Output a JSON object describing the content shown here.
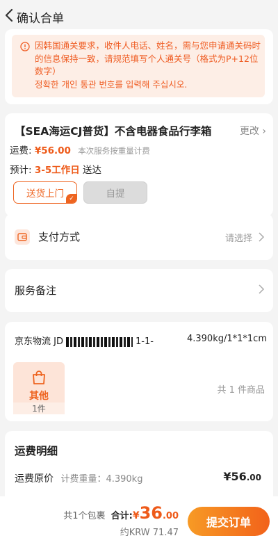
{
  "header": {
    "title": "确认合单"
  },
  "notice": {
    "text": "因韩国通关要求，收件人电话、姓名，需与您申请通关码时的信息保持一致，请规范填写个人通关号（格式为P+12位数字）",
    "text_kr": "정확한 개인 통관 번호를 입력해 주십시오."
  },
  "shipping": {
    "title": "【SEA海运CJ普货】不含电器食品行李箱",
    "change_label": "更改",
    "fee_label": "运费:",
    "fee_value": "¥56.00",
    "fee_hint": "本次服务按重量计费",
    "eta_label": "预计:",
    "eta_value": "3-5工作日",
    "eta_suffix": "送达",
    "options": {
      "door": "送货上门",
      "pickup": "自提"
    }
  },
  "payment": {
    "title": "支付方式",
    "placeholder": "请选择"
  },
  "memo": {
    "title": "服务备注"
  },
  "package": {
    "carrier_prefix": "京东物流 JD",
    "carrier_suffix": "1-1-",
    "weight_dims": "4.390kg/1*1*1cm",
    "item_name": "其他",
    "item_qty": "1件",
    "total": "共 1 件商品"
  },
  "fee_detail": {
    "title": "运费明细",
    "line_label": "运费原价",
    "line_weight": "计费重量：4.390kg",
    "amount_int": "¥56",
    "amount_dec": ".00"
  },
  "footer": {
    "packages": "共1个包裹",
    "total_label": "合计:",
    "currency": "¥",
    "total_int": "36",
    "total_dec": ".00",
    "krw": "约KRW 71.47",
    "submit": "提交订单"
  },
  "colors": {
    "accent": "#ee6420",
    "notice_bg": "#fdeee6"
  }
}
